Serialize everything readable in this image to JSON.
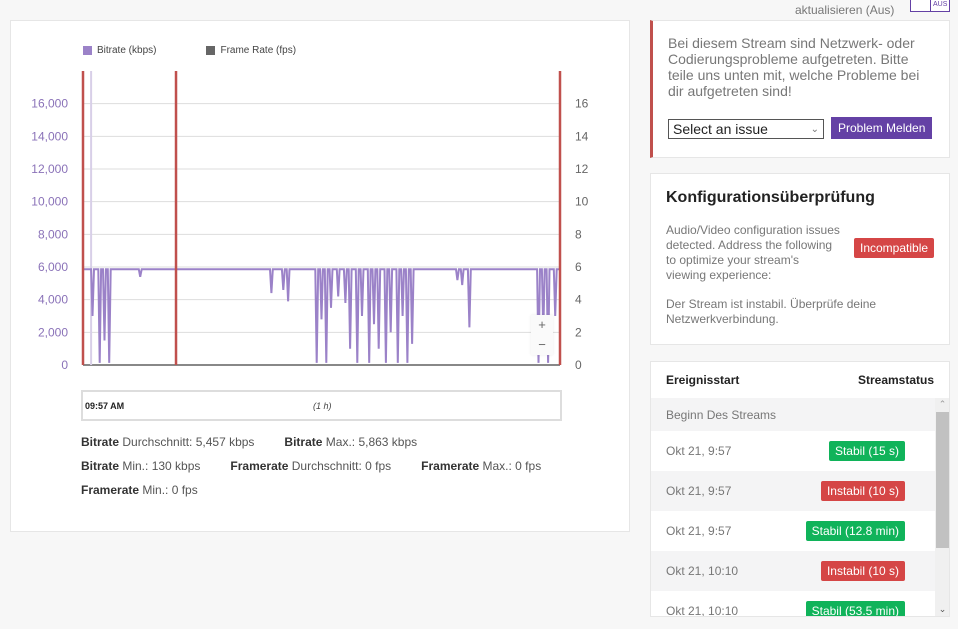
{
  "refresh": {
    "label": "aktualisieren (Aus)",
    "toggle_state": "AUS"
  },
  "chart": {
    "legend": [
      {
        "label": "Bitrate (kbps)",
        "color": "#9b82c8"
      },
      {
        "label": "Frame Rate (fps)",
        "color": "#666666"
      }
    ],
    "zoom_in": "+",
    "zoom_out": "−",
    "range_start": "09:57 AM",
    "range_duration": "(1 h)"
  },
  "chart_data": {
    "type": "line",
    "series": [
      {
        "name": "Bitrate (kbps)",
        "axis": "left",
        "color": "#9b82c8",
        "typical_value": 5863
      },
      {
        "name": "Frame Rate (fps)",
        "axis": "right",
        "color": "#666666",
        "typical_value": 0
      }
    ],
    "left_axis": {
      "ticks": [
        "0",
        "2,000",
        "4,000",
        "6,000",
        "8,000",
        "10,000",
        "12,000",
        "14,000",
        "16,000"
      ],
      "range": [
        0,
        18000
      ]
    },
    "right_axis": {
      "ticks": [
        "0",
        "2",
        "4",
        "6",
        "8",
        "10",
        "12",
        "14",
        "16"
      ],
      "range": [
        0,
        18
      ]
    },
    "event_markers": [
      0.0,
      0.195,
      1.0
    ],
    "marker_color": "#c0504d",
    "bitrate_dips": [
      [
        0.02,
        3000
      ],
      [
        0.035,
        130
      ],
      [
        0.045,
        1500
      ],
      [
        0.055,
        130
      ],
      [
        0.12,
        5400
      ],
      [
        0.395,
        4400
      ],
      [
        0.42,
        4600
      ],
      [
        0.43,
        3900
      ],
      [
        0.49,
        130
      ],
      [
        0.5,
        2800
      ],
      [
        0.51,
        130
      ],
      [
        0.52,
        3500
      ],
      [
        0.535,
        4200
      ],
      [
        0.55,
        3800
      ],
      [
        0.56,
        1000
      ],
      [
        0.575,
        130
      ],
      [
        0.585,
        3000
      ],
      [
        0.6,
        130
      ],
      [
        0.61,
        2500
      ],
      [
        0.62,
        1000
      ],
      [
        0.635,
        130
      ],
      [
        0.645,
        2000
      ],
      [
        0.66,
        130
      ],
      [
        0.67,
        3000
      ],
      [
        0.68,
        130
      ],
      [
        0.69,
        1300
      ],
      [
        0.785,
        5200
      ],
      [
        0.795,
        4900
      ],
      [
        0.81,
        2300
      ],
      [
        0.955,
        130
      ],
      [
        0.965,
        2000
      ],
      [
        0.975,
        130
      ],
      [
        0.99,
        3000
      ]
    ]
  },
  "stats": [
    [
      {
        "label": "Bitrate",
        "text": " Durchschnitt: 5,457 kbps"
      },
      {
        "label": "Bitrate",
        "text": " Max.: 5,863 kbps"
      }
    ],
    [
      {
        "label": "Bitrate",
        "text": " Min.: 130 kbps"
      },
      {
        "label": "Framerate",
        "text": " Durchschnitt: 0 fps"
      },
      {
        "label": "Framerate",
        "text": " Max.: 0 fps"
      }
    ],
    [
      {
        "label": "Framerate",
        "text": " Min.: 0 fps"
      }
    ]
  ],
  "alert": {
    "message": "Bei diesem Stream sind Netzwerk- oder Codierungsprobleme aufgetreten. Bitte teile uns unten mit, welche Probleme bei dir aufgetreten sind!",
    "select_value": "Select an issue",
    "button": "Problem Melden"
  },
  "config": {
    "title": "Konfigurationsüberprüfung",
    "description": "Audio/Video configuration issues detected. Address the following to optimize your stream's viewing experience:",
    "badge": "Incompatible",
    "note": "Der Stream ist instabil. Überprüfe deine Netzwerkverbindung."
  },
  "events": {
    "col_start": "Ereignisstart",
    "col_status": "Streamstatus",
    "rows": [
      {
        "time": "Beginn Des Streams",
        "status": "",
        "kind": ""
      },
      {
        "time": "Okt 21, 9:57",
        "status": "Stabil (15 s)",
        "kind": "stable"
      },
      {
        "time": "Okt 21, 9:57",
        "status": "Instabil (10 s)",
        "kind": "unstable"
      },
      {
        "time": "Okt 21, 9:57",
        "status": "Stabil (12.8 min)",
        "kind": "stable"
      },
      {
        "time": "Okt 21, 10:10",
        "status": "Instabil (10 s)",
        "kind": "unstable"
      },
      {
        "time": "Okt 21, 10:10",
        "status": "Stabil (53.5 min)",
        "kind": "stable"
      }
    ]
  }
}
